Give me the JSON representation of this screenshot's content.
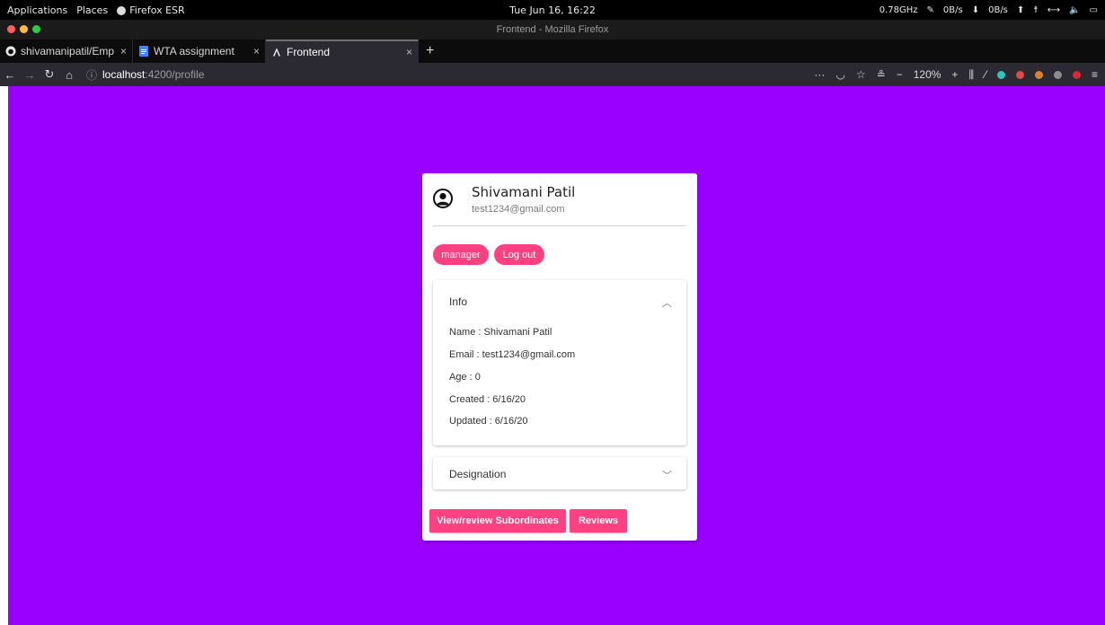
{
  "os_bar": {
    "applications": "Applications",
    "places": "Places",
    "browser": "Firefox ESR",
    "clock": "Tue Jun 16, 16:22",
    "cpu": "0.78GHz",
    "net_down": "0B/s",
    "net_up": "0B/s"
  },
  "window": {
    "title": "Frontend - Mozilla Firefox"
  },
  "tabs": [
    {
      "label": "shivamanipatil/Emp",
      "close": "×"
    },
    {
      "label": "WTA assignment",
      "close": "×"
    },
    {
      "label": "Frontend",
      "close": "×"
    }
  ],
  "new_tab": "+",
  "nav": {
    "url_host": "localhost",
    "url_path": ":4200/profile",
    "zoom": "120%",
    "zoom_minus": "−",
    "zoom_plus": "+"
  },
  "profile": {
    "name": "Shivamani Patil",
    "email": "test1234@gmail.com",
    "role_button": "manager",
    "logout_button": "Log out",
    "info_panel": {
      "title": "Info",
      "lines": [
        "Name : Shivamani Patil",
        "Email : test1234@gmail.com",
        "Age : 0",
        "Created : 6/16/20",
        "Updated : 6/16/20"
      ]
    },
    "designation_panel": {
      "title": "Designation"
    },
    "subordinates_button": "View/review Subordinates",
    "reviews_button": "Reviews"
  },
  "colors": {
    "page_bg": "#9900ff",
    "accent": "#ff4081"
  }
}
